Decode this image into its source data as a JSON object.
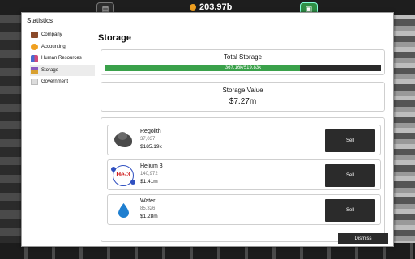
{
  "hud": {
    "money": "203.97b",
    "coin_color": "#f0a020"
  },
  "modal": {
    "title": "Statistics",
    "dismiss_label": "Dismiss"
  },
  "sidebar": {
    "items": [
      {
        "label": "Company",
        "icon": "briefcase-icon"
      },
      {
        "label": "Accounting",
        "icon": "coins-icon"
      },
      {
        "label": "Human Resources",
        "icon": "people-icon"
      },
      {
        "label": "Storage",
        "icon": "storage-icon"
      },
      {
        "label": "Government",
        "icon": "government-icon"
      }
    ],
    "active_index": 3
  },
  "storage": {
    "title": "Storage",
    "total_label": "Total Storage",
    "total_text": "367.16k/519.83k",
    "total_fraction": 0.706,
    "value_label": "Storage Value",
    "value": "$7.27m",
    "bar_color": "#3aa14a",
    "resources": [
      {
        "name": "Regolith",
        "amount": "37,037",
        "price": "$185.19k",
        "sell_label": "Sell",
        "icon": "regolith-rock-icon"
      },
      {
        "name": "Helium 3",
        "amount": "140,972",
        "price": "$1.41m",
        "sell_label": "Sell",
        "icon": "helium3-icon",
        "icon_text": "He-3"
      },
      {
        "name": "Water",
        "amount": "85,326",
        "price": "$1.28m",
        "sell_label": "Sell",
        "icon": "water-drop-icon"
      }
    ]
  }
}
